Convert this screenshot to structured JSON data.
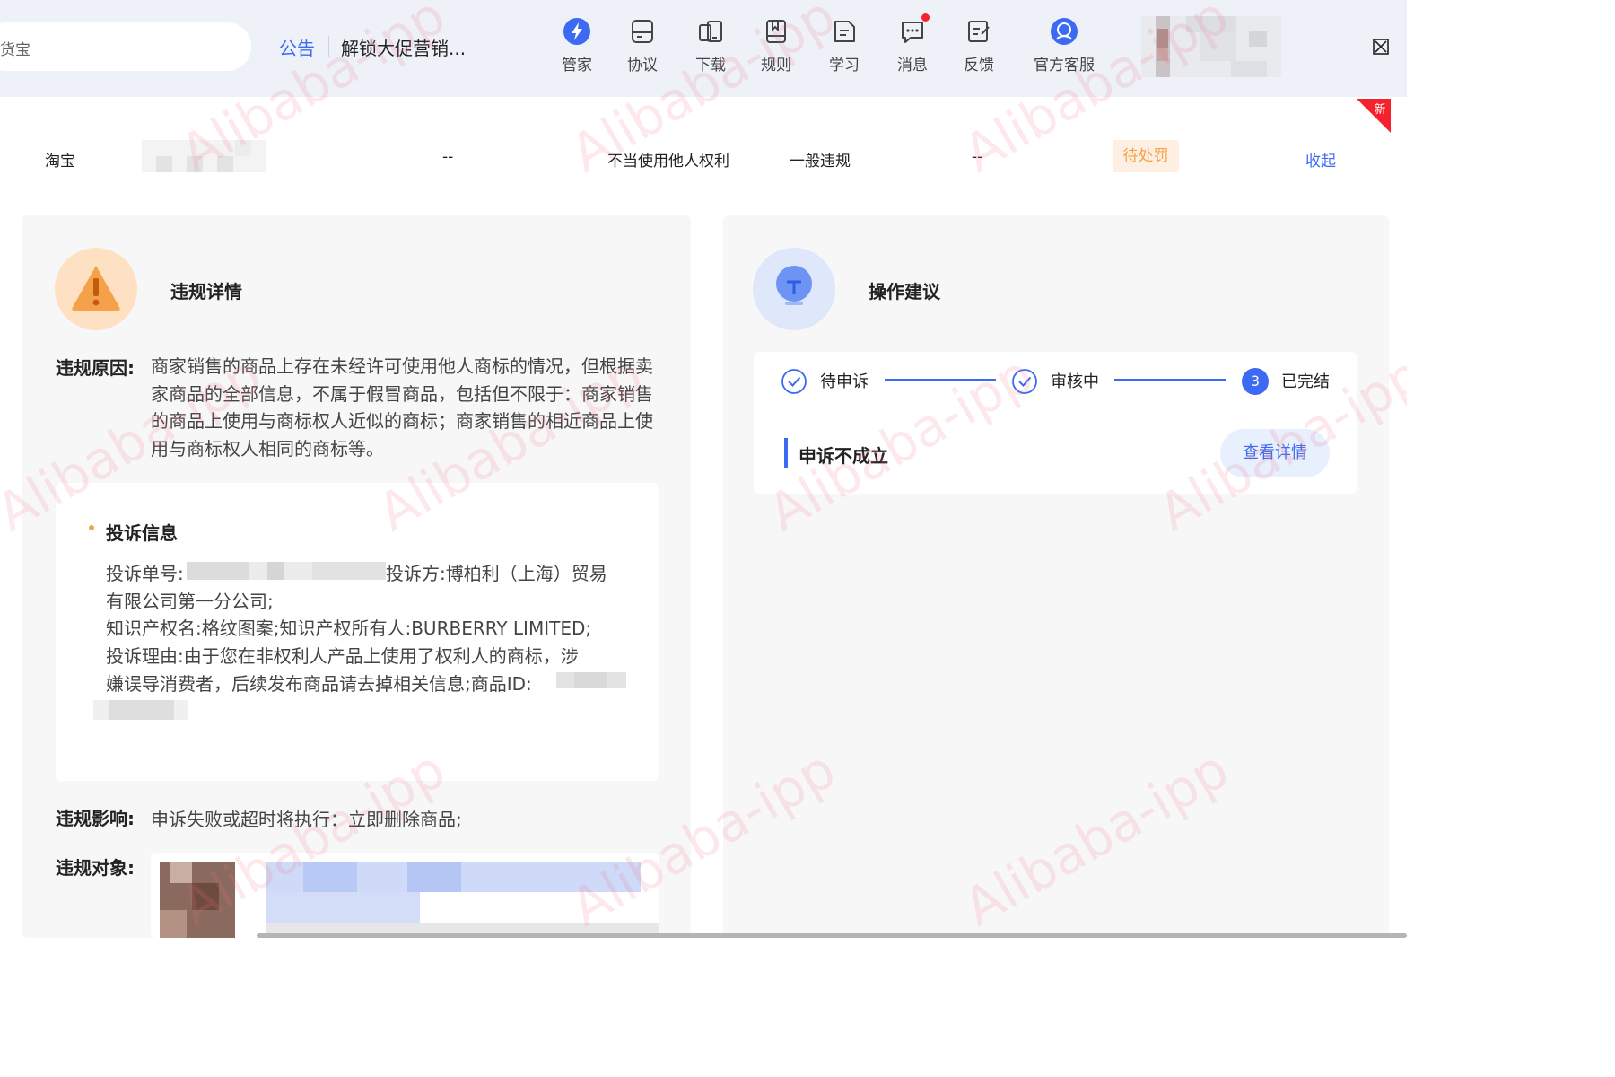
{
  "header": {
    "search_text": "货宝",
    "notice_label": "公告",
    "notice_text": "解锁大促营销...",
    "nav": [
      {
        "label": "管家",
        "icon": "butler-lightning-icon"
      },
      {
        "label": "协议",
        "icon": "agreement-icon"
      },
      {
        "label": "下载",
        "icon": "download-devices-icon"
      },
      {
        "label": "规则",
        "icon": "rules-book-icon"
      },
      {
        "label": "学习",
        "icon": "learning-icon"
      },
      {
        "label": "消息",
        "icon": "message-icon",
        "has_dot": true
      },
      {
        "label": "反馈",
        "icon": "feedback-icon"
      },
      {
        "label": "官方客服",
        "icon": "customer-service-icon"
      }
    ]
  },
  "summary_row": {
    "platform": "淘宝",
    "field_a": "--",
    "violation_type": "不当使用他人权利",
    "severity": "一般违规",
    "field_b": "--",
    "status": "待处罚",
    "collapse_label": "收起",
    "new_badge": "新"
  },
  "violation_detail": {
    "title": "违规详情",
    "reason_label": "违规原因:",
    "reason_text": "商家销售的商品上存在未经许可使用他人商标的情况，但根据卖家商品的全部信息，不属于假冒商品，包括但不限于：商家销售的商品上使用与商标权人近似的商标；商家销售的相近商品上使用与商标权人相同的商标等。",
    "complaint": {
      "title": "投诉信息",
      "line1_prefix": "投诉单号:",
      "line1_suffix": "投诉方:博柏利（上海）贸易",
      "line2": "有限公司第一分公司;",
      "line3": "知识产权名:格纹图案;知识产权所有人:BURBERRY LIMITED;",
      "line4": "投诉理由:由于您在非权利人产品上使用了权利人的商标，涉",
      "line5": "嫌误导消费者，后续发布商品请去掉相关信息;商品ID:"
    },
    "impact_label": "违规影响:",
    "impact_text": "申诉失败或超时将执行：立即删除商品;",
    "target_label": "违规对象:"
  },
  "suggestion": {
    "title": "操作建议",
    "steps": [
      {
        "label": "待申诉",
        "state": "done"
      },
      {
        "label": "审核中",
        "state": "done"
      },
      {
        "label": "已完结",
        "number": "3",
        "state": "current"
      }
    ],
    "result": "申诉不成立",
    "detail_button": "查看详情"
  },
  "watermark": "Alibaba-ipp",
  "colors": {
    "accent": "#3d6af2",
    "warning": "#f5a14a",
    "alert_red": "#f5222d"
  }
}
